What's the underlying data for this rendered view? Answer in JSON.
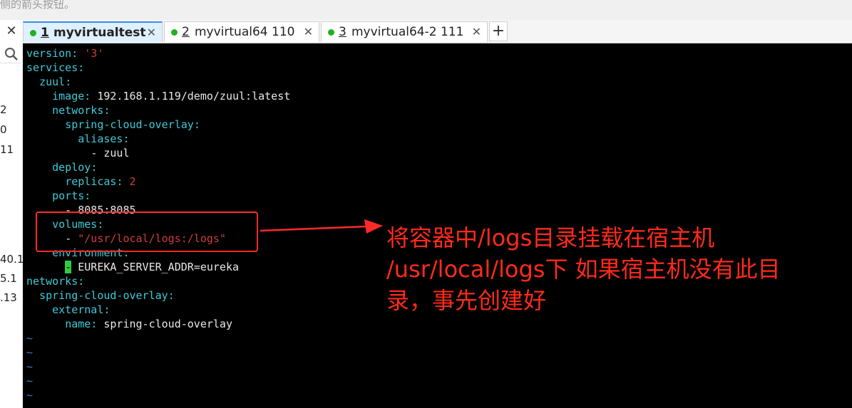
{
  "top_hint": "侧的箭头按钮。",
  "sidebar": {
    "close_all": "✕",
    "fragments": [
      "2",
      "0",
      "11",
      "40.1",
      "5.1",
      ".13"
    ]
  },
  "tabs": [
    {
      "num": "1",
      "label": "myvirtualtest",
      "close": "✕",
      "active": true
    },
    {
      "num": "2",
      "label": "myvirtual64 110",
      "close": "✕",
      "active": false
    },
    {
      "num": "3",
      "label": "myvirtual64-2 111",
      "close": "✕",
      "active": false
    }
  ],
  "add_tab": "+",
  "editor": {
    "lines": [
      {
        "indent": "",
        "key": "version",
        "sep": ": ",
        "val": "'3'",
        "valType": "s"
      },
      {
        "indent": "",
        "key": "services",
        "sep": ":",
        "val": "",
        "valType": "v"
      },
      {
        "indent": "  ",
        "key": "zuul",
        "sep": ":",
        "val": "",
        "valType": "v"
      },
      {
        "indent": "    ",
        "key": "image",
        "sep": ": ",
        "val": "192.168.1.119/demo/zuul:latest",
        "valType": "v"
      },
      {
        "indent": "    ",
        "key": "networks",
        "sep": ":",
        "val": "",
        "valType": "v"
      },
      {
        "indent": "      ",
        "key": "spring-cloud-overlay",
        "sep": ":",
        "val": "",
        "valType": "v"
      },
      {
        "indent": "        ",
        "key": "aliases",
        "sep": ":",
        "val": "",
        "valType": "v"
      },
      {
        "indent": "          ",
        "key": "",
        "sep": "- ",
        "val": "zuul",
        "valType": "v"
      },
      {
        "indent": "    ",
        "key": "deploy",
        "sep": ":",
        "val": "",
        "valType": "v"
      },
      {
        "indent": "      ",
        "key": "replicas",
        "sep": ": ",
        "val": "2",
        "valType": "n"
      },
      {
        "indent": "    ",
        "key": "ports",
        "sep": ":",
        "val": "",
        "valType": "v"
      },
      {
        "indent": "      ",
        "key": "",
        "sep": "- ",
        "val": "8085:8085",
        "valType": "v"
      },
      {
        "indent": "    ",
        "key": "volumes",
        "sep": ":",
        "val": "",
        "valType": "v"
      },
      {
        "indent": "      ",
        "key": "",
        "sep": "- ",
        "val": "\"/usr/local/logs:/logs\"",
        "valType": "s"
      },
      {
        "indent": "    ",
        "key": "environment",
        "sep": ":",
        "val": "",
        "valType": "v"
      },
      {
        "indent": "      ",
        "key": "",
        "sep": "-",
        "val": " EUREKA_SERVER_ADDR=eureka",
        "valType": "v",
        "cursor": true
      },
      {
        "indent": "",
        "key": "networks",
        "sep": ":",
        "val": "",
        "valType": "v"
      },
      {
        "indent": "  ",
        "key": "spring-cloud-overlay",
        "sep": ":",
        "val": "",
        "valType": "v"
      },
      {
        "indent": "    ",
        "key": "external",
        "sep": ":",
        "val": "",
        "valType": "v"
      },
      {
        "indent": "      ",
        "key": "name",
        "sep": ": ",
        "val": "spring-cloud-overlay",
        "valType": "v"
      }
    ],
    "tildes": [
      "~",
      "~",
      "~",
      "~",
      "~"
    ]
  },
  "annotation": {
    "lines": [
      "将容器中/logs目录挂载在宿主机",
      "/usr/local/logs下 如果宿主机没有此目",
      "录，事先创建好"
    ],
    "color": "#ff2a1a"
  }
}
